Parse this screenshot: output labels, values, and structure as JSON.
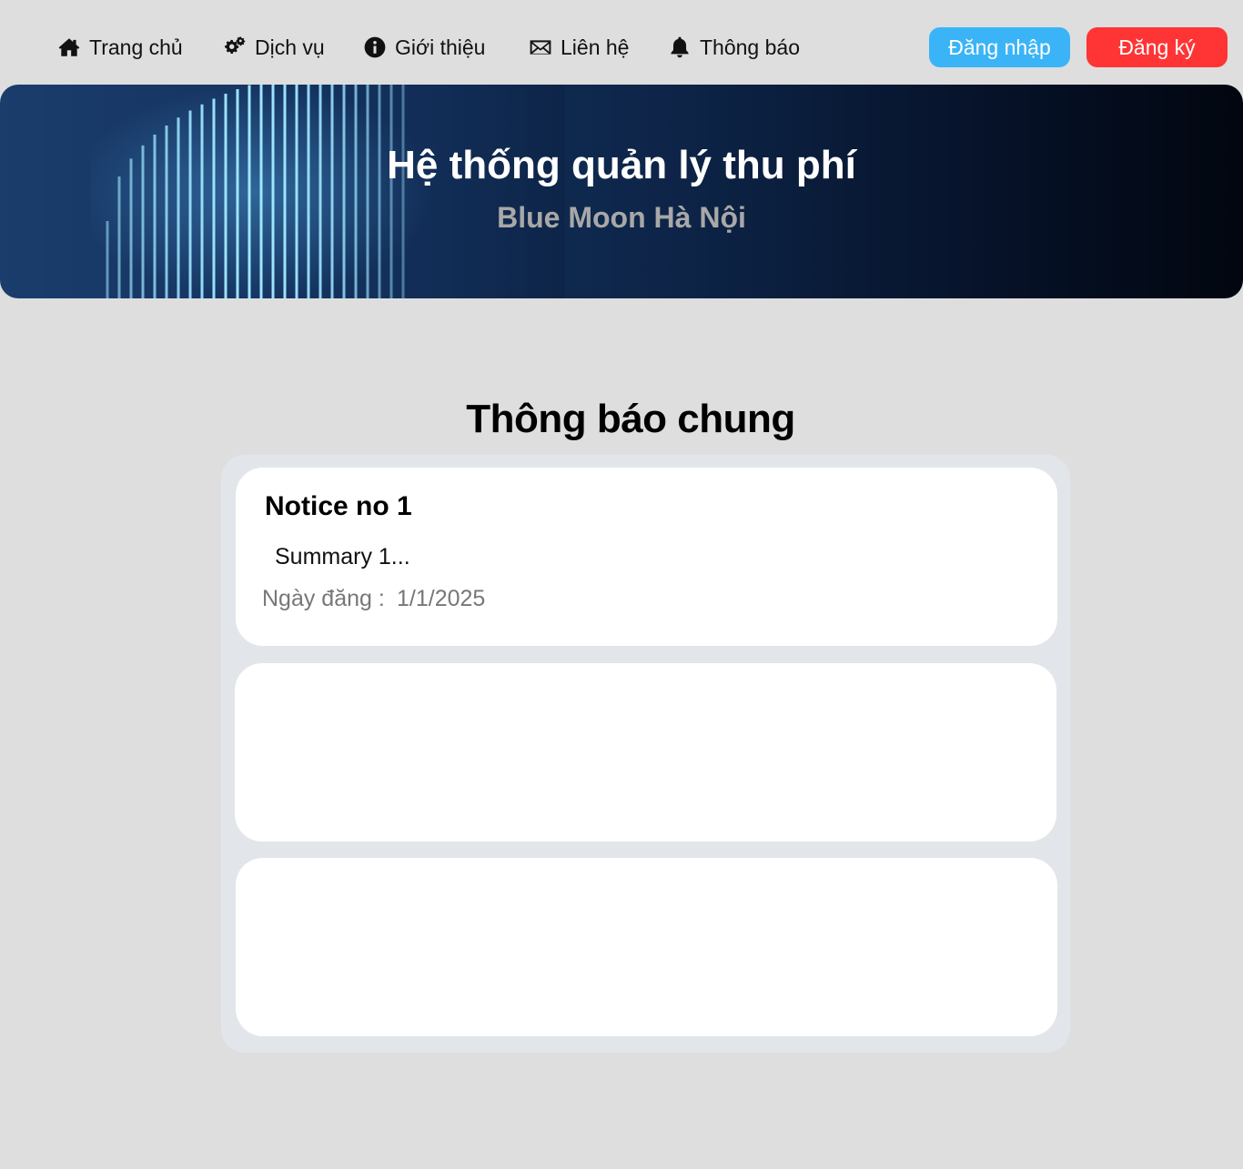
{
  "nav": {
    "items": [
      {
        "label": "Trang chủ",
        "icon": "home-icon"
      },
      {
        "label": "Dịch vụ",
        "icon": "gears-icon"
      },
      {
        "label": "Giới thiệu",
        "icon": "info-icon"
      },
      {
        "label": "Liên hệ",
        "icon": "mail-icon"
      },
      {
        "label": "Thông báo",
        "icon": "bell-icon"
      }
    ],
    "login_label": "Đăng nhập",
    "register_label": "Đăng ký"
  },
  "hero": {
    "title": "Hệ thống quản lý thu phí",
    "subtitle": "Blue Moon Hà Nội"
  },
  "notices": {
    "section_title": "Thông báo chung",
    "items": [
      {
        "title": "Notice no 1",
        "summary": "Summary 1...",
        "date_label": "Ngày đăng :",
        "date": "1/1/2025"
      },
      {
        "title": "",
        "summary": "",
        "date_label": "",
        "date": ""
      },
      {
        "title": "",
        "summary": "",
        "date_label": "",
        "date": ""
      }
    ]
  },
  "colors": {
    "page_bg": "#dedede",
    "login_button": "#3bb4f7",
    "register_button": "#ff3434",
    "hero_dark": "#02060f",
    "hero_light": "#1a3d6c",
    "panel_bg": "#e2e6ea",
    "card_bg": "#ffffff"
  }
}
